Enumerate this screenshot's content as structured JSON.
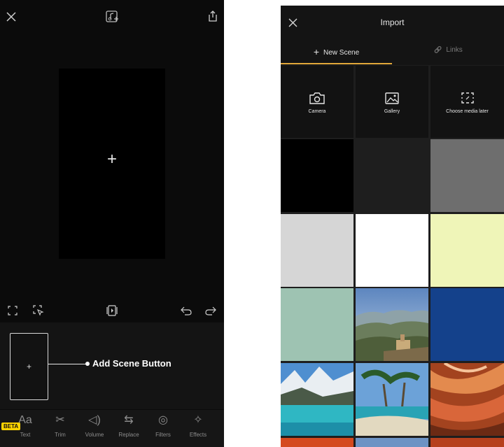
{
  "editor": {
    "canvas_plus": "+",
    "scene_plus": "+",
    "callout": "Add Scene Button",
    "beta_badge": "BETA",
    "tools": [
      {
        "label": "Text",
        "icon": "Aa"
      },
      {
        "label": "Trim",
        "icon": "✂"
      },
      {
        "label": "Volume",
        "icon": "◁)"
      },
      {
        "label": "Replace",
        "icon": "⇆"
      },
      {
        "label": "Filters",
        "icon": "◎"
      },
      {
        "label": "Effects",
        "icon": "✧"
      }
    ],
    "icons": {
      "close": "close-icon",
      "music_add": "music-add-icon",
      "share": "share-icon",
      "fullscreen": "fullscreen-icon",
      "select": "select-icon",
      "preview": "preview-icon",
      "undo": "undo-icon",
      "redo": "redo-icon"
    }
  },
  "import": {
    "title": "Import",
    "tabs": [
      {
        "label": "New Scene",
        "icon": "+",
        "active": true
      },
      {
        "label": "Links",
        "icon": "🔗",
        "active": false
      }
    ],
    "options": [
      {
        "label": "Camera",
        "icon": "camera-icon"
      },
      {
        "label": "Gallery",
        "icon": "gallery-icon"
      },
      {
        "label": "Choose media later",
        "icon": "choose-later-icon"
      }
    ],
    "accent_color": "#e2a83a",
    "swatches": [
      "#000000",
      "#1e1e1e",
      "#6e6e6e",
      "#d6d6d6",
      "#ffffff",
      "#eff5b8",
      "#9ec3b2",
      "#14418b"
    ]
  }
}
